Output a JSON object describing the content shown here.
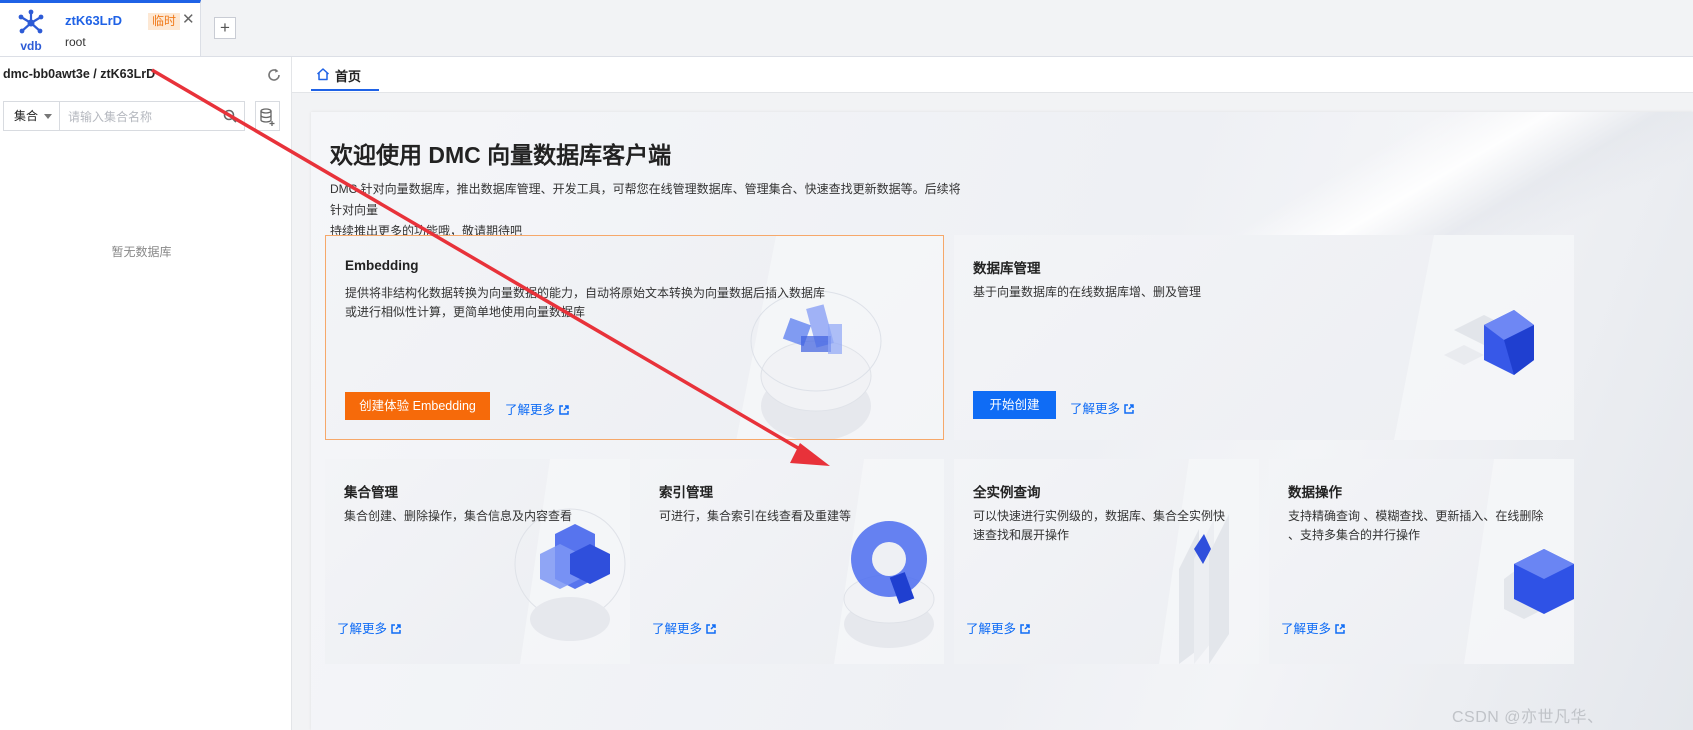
{
  "connection_tab": {
    "logo_text": "vdb",
    "name": "ztK63LrD",
    "user": "root",
    "badge": "临时",
    "close_symbol": "✕",
    "add_symbol": "+"
  },
  "sidebar": {
    "breadcrumb": "dmc-bb0awt3e / ztK63LrD",
    "type_select": "集合",
    "search_placeholder": "请输入集合名称",
    "empty_text": "暂无数据库"
  },
  "nav": {
    "home_tab": "首页"
  },
  "welcome": {
    "title": "欢迎使用 DMC 向量数据库客户端",
    "desc_line1": "DMC 针对向量数据库，推出数据库管理、开发工具，可帮您在线管理数据库、管理集合、快速查找更新数据等。后续将针对向量",
    "desc_line2": "持续推出更多的功能哦，敬请期待吧"
  },
  "cards": {
    "embedding": {
      "title": "Embedding",
      "desc_line1": "提供将非结构化数据转换为向量数据的能力，自动将原始文本转换为向量数据后插入数据库",
      "desc_line2": "或进行相似性计算，更简单地使用向量数据库",
      "button": "创建体验 Embedding",
      "link": "了解更多"
    },
    "database": {
      "title": "数据库管理",
      "desc_line1": "基于向量数据库的在线数据库增、删及管理",
      "button": "开始创建",
      "link": "了解更多"
    },
    "collection": {
      "title": "集合管理",
      "desc_line1": "集合创建、删除操作，集合信息及内容查看",
      "link": "了解更多"
    },
    "index": {
      "title": "索引管理",
      "desc_line1": "可进行，集合索引在线查看及重建等",
      "link": "了解更多"
    },
    "instance": {
      "title": "全实例查询",
      "desc_line1": "可以快速进行实例级的，数据库、集合全实例快",
      "desc_line2": "速查找和展开操作",
      "link": "了解更多"
    },
    "data_ops": {
      "title": "数据操作",
      "desc_line1": "支持精确查询 、模糊查找、更新插入、在线删除",
      "desc_line2": "、支持多集合的并行操作",
      "link": "了解更多"
    }
  },
  "watermark": "CSDN @亦世凡华、",
  "colors": {
    "accent_blue": "#0f6cf5",
    "accent_orange": "#f66a0a",
    "badge_bg": "#fde8d4",
    "annotation_red": "#e8323a"
  },
  "icons": [
    "vdb-logo-icon",
    "close-icon",
    "plus-icon",
    "refresh-icon",
    "caret-down-icon",
    "search-icon",
    "add-database-icon",
    "home-icon",
    "external-link-icon"
  ]
}
